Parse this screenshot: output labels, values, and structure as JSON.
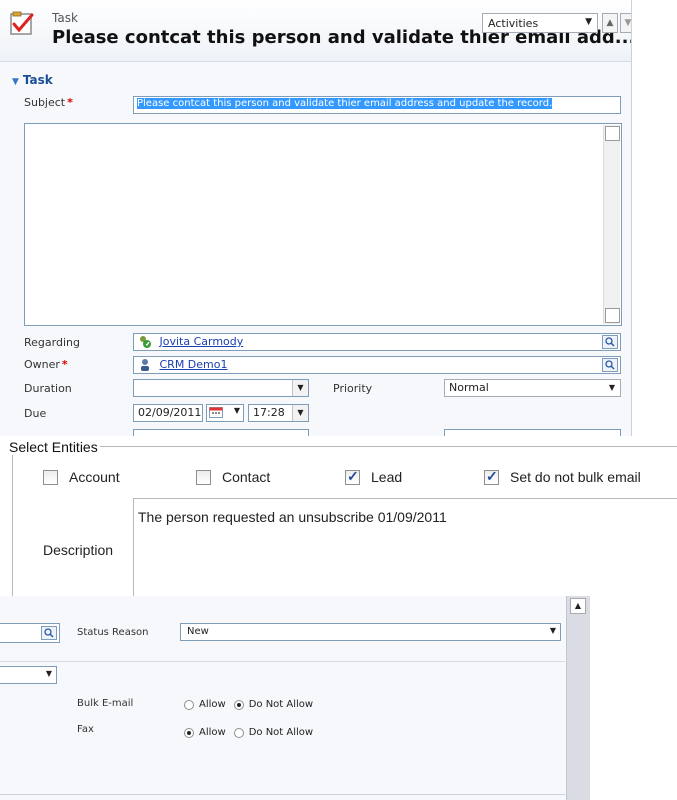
{
  "task": {
    "entity_label": "Task",
    "record_title": "Please contcat this person and validate thier email add...",
    "activities_dropdown": "Activities",
    "section_title": "Task",
    "fields": {
      "subject_label": "Subject",
      "subject_value": "Please contcat this person and validate thier email address and update the record.",
      "regarding_label": "Regarding",
      "regarding_value": "Jovita Carmody",
      "owner_label": "Owner",
      "owner_value": "CRM Demo1",
      "duration_label": "Duration",
      "duration_value": "",
      "priority_label": "Priority",
      "priority_value": "Normal",
      "due_label": "Due",
      "due_date": "02/09/2011",
      "due_time": "17:28",
      "required_marker": "*"
    }
  },
  "entities_dialog": {
    "group_title": "Select Entities",
    "checkboxes": [
      {
        "label": "Account",
        "checked": false
      },
      {
        "label": "Contact",
        "checked": false
      },
      {
        "label": "Lead",
        "checked": true
      },
      {
        "label": "Set do not bulk email",
        "checked": true
      }
    ],
    "description_label": "Description",
    "description_value": "The person requested an unsubscribe 01/09/2011"
  },
  "status_panel": {
    "status_reason_label": "Status Reason",
    "status_reason_value": "New",
    "bulk_email_label": "Bulk E-mail",
    "fax_label": "Fax",
    "allow_label": "Allow",
    "do_not_allow_label": "Do Not Allow",
    "bulk_email_selected": "Do Not Allow",
    "fax_selected": "Allow"
  },
  "colors": {
    "section_title": "#1a4f95",
    "link": "#1a40b0",
    "selection": "#3399ff",
    "required": "#dd0000"
  }
}
